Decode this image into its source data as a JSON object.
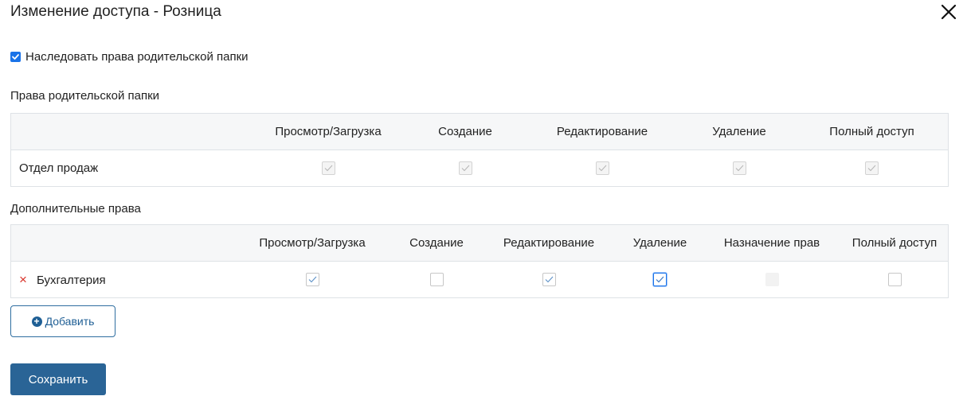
{
  "dialog": {
    "title": "Изменение доступа - Розница"
  },
  "inherit": {
    "label": "Наследовать права родительской папки",
    "checked": true
  },
  "parent_rights": {
    "title": "Права родительской папки",
    "columns": [
      "Просмотр/Загрузка",
      "Создание",
      "Редактирование",
      "Удаление",
      "Полный доступ"
    ],
    "rows": [
      {
        "name": "Отдел продаж",
        "values": [
          true,
          true,
          true,
          true,
          true
        ],
        "disabled": true
      }
    ]
  },
  "additional_rights": {
    "title": "Дополнительные права",
    "columns": [
      "Просмотр/Загрузка",
      "Создание",
      "Редактирование",
      "Удаление",
      "Назначение прав",
      "Полный доступ"
    ],
    "rows": [
      {
        "name": "Бухгалтерия",
        "remove_icon": "×",
        "values": [
          true,
          false,
          true,
          true,
          false,
          false
        ]
      }
    ]
  },
  "buttons": {
    "add_label": "Добавить",
    "save_label": "Сохранить"
  },
  "icons": {
    "close": "close-icon",
    "check": "check-icon",
    "plus": "plus-circle-icon",
    "remove": "remove-icon"
  }
}
